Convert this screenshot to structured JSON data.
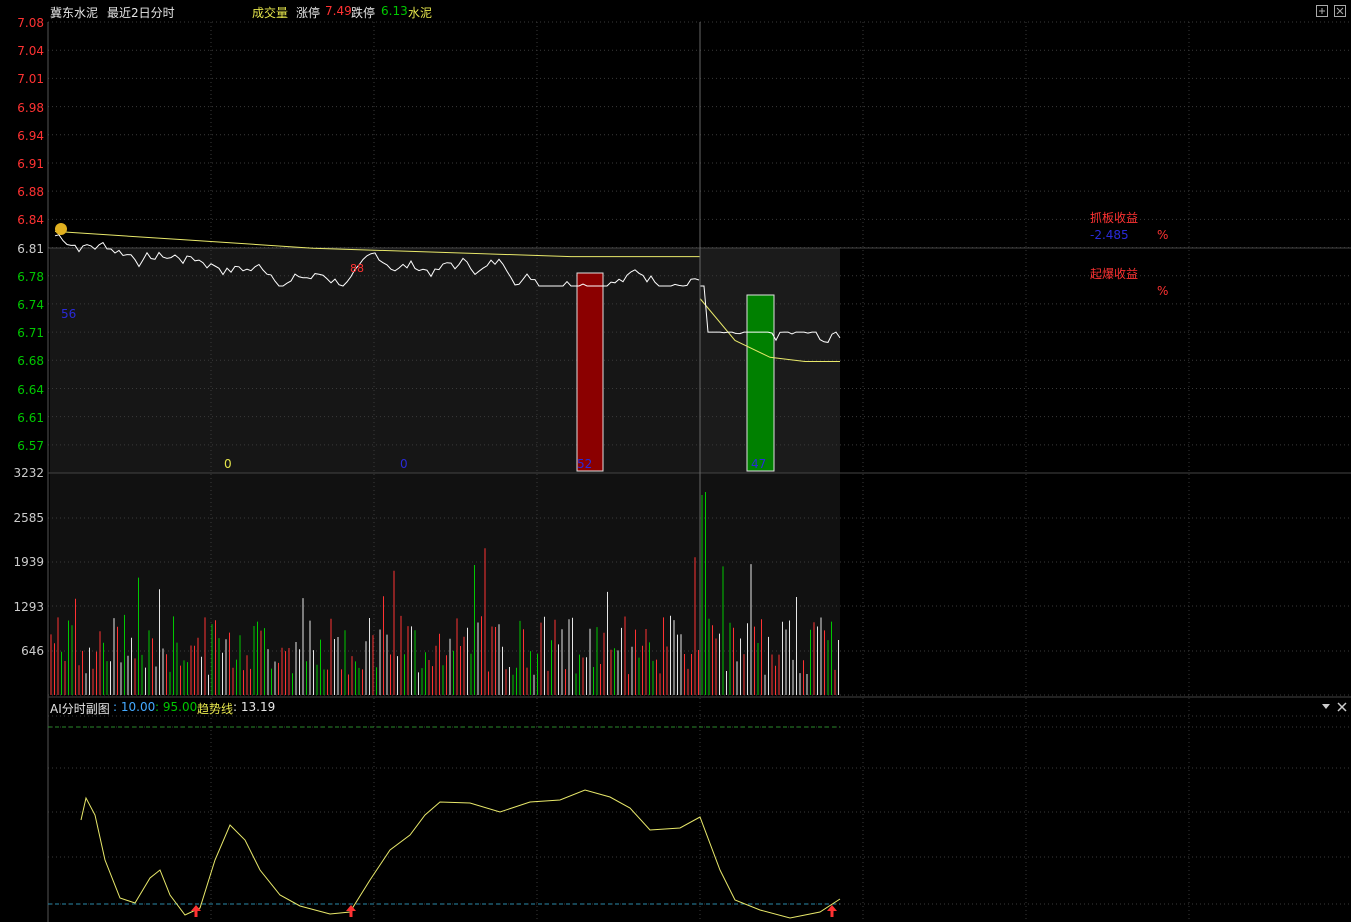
{
  "header": {
    "stock_name": "冀东水泥",
    "period": "最近2日分时",
    "volume_label": "成交量",
    "limit_up_label": "涨停",
    "limit_up_value": "7.49",
    "limit_down_label": "跌停",
    "limit_down_value": "6.13",
    "sector": "水泥"
  },
  "price_axis": [
    "7.08",
    "7.04",
    "7.01",
    "6.98",
    "6.94",
    "6.91",
    "6.88",
    "6.84",
    "6.81",
    "6.78",
    "6.74",
    "6.71",
    "6.68",
    "6.64",
    "6.61",
    "6.57"
  ],
  "volume_axis": [
    "3232",
    "2585",
    "1939",
    "1293",
    "646"
  ],
  "price_markers": [
    {
      "text": "0",
      "color": "#e6e64c"
    },
    {
      "text": "0",
      "color": "#2a2ad8"
    },
    {
      "text": "52",
      "color": "#2a2ad8"
    },
    {
      "text": "47",
      "color": "#2a2ad8"
    }
  ],
  "left_marker": "56",
  "red_marker": "88",
  "right_panel": {
    "grab_label": "抓板收益",
    "grab_value": "-2.485",
    "grab_unit": "%",
    "burst_label": "起爆收益",
    "burst_unit": "%"
  },
  "sub_chart": {
    "title": "AI分时副图",
    "value1": ": 10.00",
    "value2": ": 95.00",
    "trend_label": "趋势线",
    "trend_value": ": 13.19"
  },
  "colors": {
    "up": "#ff3232",
    "down": "#00c800",
    "price_line": "#ffffff",
    "avg_line": "#e8e86a",
    "grid": "#3a3a3a"
  },
  "chart_data": {
    "type": "line",
    "price_avg_day1": [
      6.84,
      6.83,
      6.82,
      6.815,
      6.81,
      6.81
    ],
    "price_avg_day2": [
      6.76,
      6.71,
      6.69,
      6.685,
      6.685
    ],
    "volume_axis_max": 3232,
    "trend_value": 13.19
  }
}
